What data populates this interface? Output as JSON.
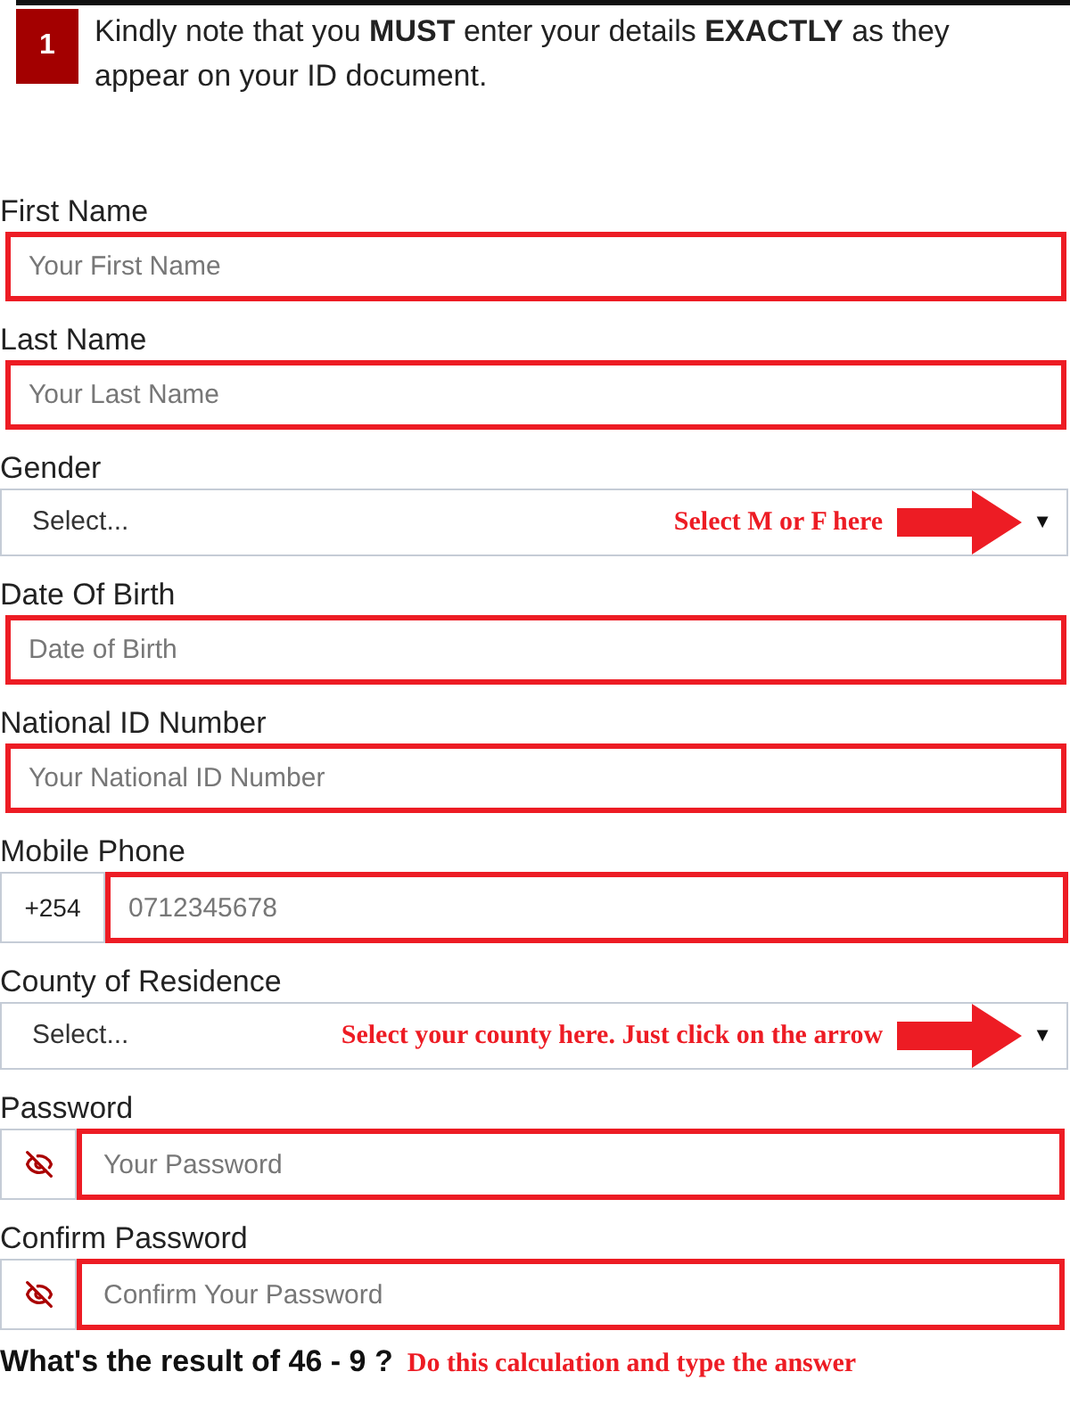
{
  "notice": {
    "step": "1",
    "text": "Kindly note that you **MUST** enter your details **EXACTLY** as they appear on your ID document."
  },
  "fields": [
    {
      "kind": "text",
      "label": "First Name",
      "placeholder": "Your First Name",
      "highlighted": true
    },
    {
      "kind": "text",
      "label": "Last Name",
      "placeholder": "Your Last Name",
      "highlighted": true
    },
    {
      "kind": "select",
      "label": "Gender",
      "value": "Select...",
      "note": "Select M or F here",
      "caret": "▼",
      "highlighted": false
    },
    {
      "kind": "text",
      "label": "Date Of Birth",
      "placeholder": "Date of Birth",
      "highlighted": true
    },
    {
      "kind": "text",
      "label": "National ID Number",
      "placeholder": "Your National ID Number",
      "highlighted": true
    },
    {
      "kind": "phone",
      "label": "Mobile Phone",
      "prefix": "+254",
      "placeholder": "0712345678",
      "highlighted": true
    },
    {
      "kind": "select",
      "label": "County of Residence",
      "value": "Select...",
      "note": "Select your county here. Just click on the arrow",
      "caret": "▼",
      "highlighted": false
    },
    {
      "kind": "password",
      "label": "Password",
      "placeholder": "Your Password",
      "highlighted": true
    },
    {
      "kind": "password",
      "label": "Confirm Password",
      "placeholder": "Confirm Your Password",
      "highlighted": true
    }
  ],
  "question": {
    "text": "What's the result of 46 - 9 ?",
    "note": "Do this calculation and type the answer"
  }
}
